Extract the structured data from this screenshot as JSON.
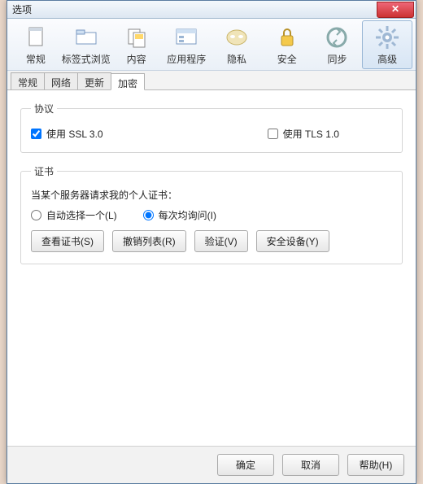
{
  "window": {
    "title": "选项"
  },
  "toolbar": {
    "items": [
      {
        "label": "常规"
      },
      {
        "label": "标签式浏览"
      },
      {
        "label": "内容"
      },
      {
        "label": "应用程序"
      },
      {
        "label": "隐私"
      },
      {
        "label": "安全"
      },
      {
        "label": "同步"
      },
      {
        "label": "高级"
      }
    ]
  },
  "tabs": {
    "items": [
      {
        "label": "常规"
      },
      {
        "label": "网络"
      },
      {
        "label": "更新"
      },
      {
        "label": "加密"
      }
    ],
    "active_index": 3
  },
  "protocol": {
    "legend": "协议",
    "ssl": {
      "label": "使用 SSL 3.0",
      "checked": true
    },
    "tls": {
      "label": "使用 TLS 1.0",
      "checked": false
    }
  },
  "cert": {
    "legend": "证书",
    "prompt": "当某个服务器请求我的个人证书：",
    "auto": {
      "label": "自动选择一个(L)",
      "checked": false
    },
    "ask": {
      "label": "每次均询问(I)",
      "checked": true
    },
    "buttons": {
      "view": "查看证书(S)",
      "revoke": "撤销列表(R)",
      "verify": "验证(V)",
      "device": "安全设备(Y)"
    }
  },
  "footer": {
    "ok": "确定",
    "cancel": "取消",
    "help": "帮助(H)"
  }
}
